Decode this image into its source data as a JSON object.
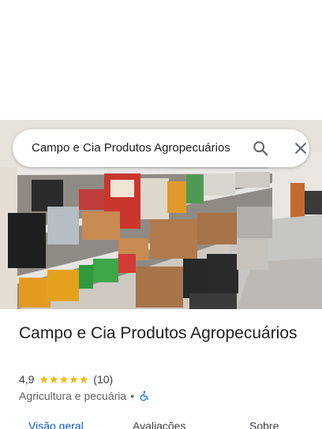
{
  "search": {
    "query": "Campo e Cia Produtos Agropecuários",
    "search_icon": "search-icon",
    "close_icon": "close-icon"
  },
  "place": {
    "name": "Campo e Cia Produtos Agropecuários",
    "rating": "4,9",
    "stars": 5,
    "review_count": "(10)",
    "category": "Agricultura e pecuária",
    "separator": "•",
    "accessibility_icon": "wheelchair-accessible-icon",
    "star_color": "#f4b400"
  },
  "tabs": [
    {
      "label": "Visão geral",
      "active": true
    },
    {
      "label": "Avaliações",
      "active": false
    },
    {
      "label": "Sobre",
      "active": false
    }
  ],
  "colors": {
    "accent": "#0b57d0",
    "text": "#202124",
    "secondary_text": "#5f6368"
  }
}
